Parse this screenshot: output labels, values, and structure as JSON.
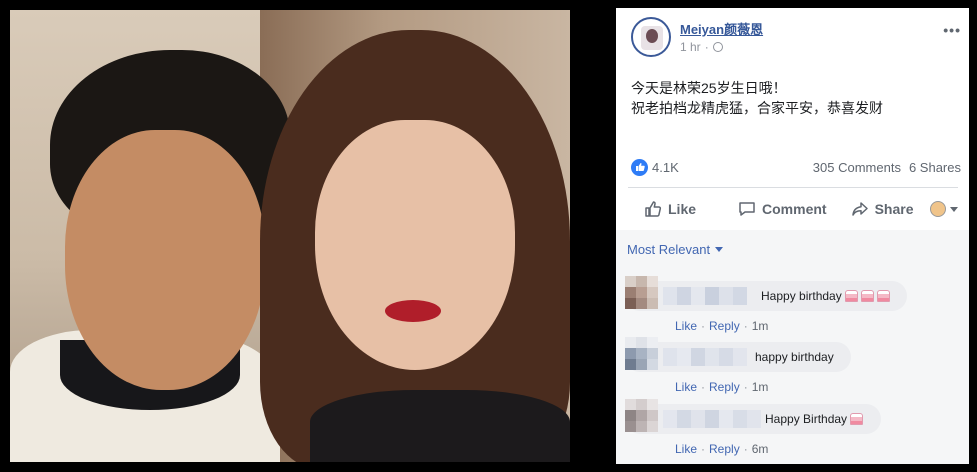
{
  "post": {
    "author": "Meiyan颜薇恩",
    "time": "1 hr",
    "more_icon": "ellipsis-icon",
    "text_line1": "今天是林荣25岁生日哦！",
    "text_line2": "祝老拍档龙精虎猛，合家平安，恭喜发财",
    "reaction_count": "4.1K",
    "comments_count": "305 Comments",
    "shares_count": "6 Shares"
  },
  "actions": {
    "like": "Like",
    "comment": "Comment",
    "share": "Share"
  },
  "comments_section": {
    "sort_label": "Most Relevant",
    "like_label": "Like",
    "reply_label": "Reply",
    "separator": "·",
    "items": [
      {
        "text": "Happy birthday",
        "cakes": 3,
        "time": "1m"
      },
      {
        "text": "happy birthday",
        "cakes": 0,
        "time": "1m"
      },
      {
        "text": "Happy Birthday",
        "cakes": 1,
        "time": "6m"
      }
    ]
  },
  "colors": {
    "link_blue": "#365899",
    "accent_blue": "#4267b2",
    "like_blue": "#2f7cf6",
    "secondary_text": "#606770"
  }
}
